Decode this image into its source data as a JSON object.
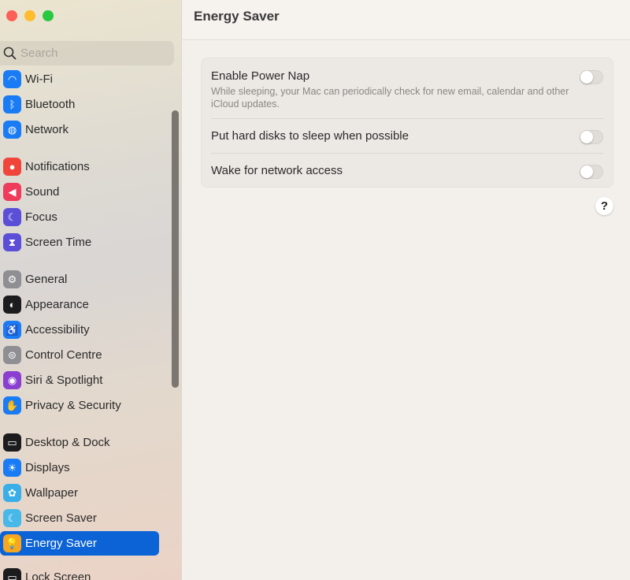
{
  "window": {
    "title": "Energy Saver"
  },
  "search": {
    "placeholder": "Search"
  },
  "sidebar": {
    "items": [
      {
        "label": "Wi-Fi",
        "icon": "wifi-icon",
        "color": "#1a7cf5",
        "glyph": "◠"
      },
      {
        "label": "Bluetooth",
        "icon": "bluetooth-icon",
        "color": "#1a7cf5",
        "glyph": "ᛒ"
      },
      {
        "label": "Network",
        "icon": "globe-icon",
        "color": "#1a7cf5",
        "glyph": "◍"
      },
      {
        "label": "Notifications",
        "icon": "bell-icon",
        "color": "#f0453a",
        "glyph": "●"
      },
      {
        "label": "Sound",
        "icon": "speaker-icon",
        "color": "#ee3b5b",
        "glyph": "◀"
      },
      {
        "label": "Focus",
        "icon": "moon-icon",
        "color": "#5a4fd6",
        "glyph": "☾"
      },
      {
        "label": "Screen Time",
        "icon": "hourglass-icon",
        "color": "#5a4fd6",
        "glyph": "⧗"
      },
      {
        "label": "General",
        "icon": "gear-icon",
        "color": "#8e8e93",
        "glyph": "⚙"
      },
      {
        "label": "Appearance",
        "icon": "appearance-icon",
        "color": "#1c1c1e",
        "glyph": "◐"
      },
      {
        "label": "Accessibility",
        "icon": "accessibility-icon",
        "color": "#1a7cf5",
        "glyph": "♿"
      },
      {
        "label": "Control Centre",
        "icon": "toggles-icon",
        "color": "#8e8e93",
        "glyph": "⊜"
      },
      {
        "label": "Siri & Spotlight",
        "icon": "siri-icon",
        "color": "#8a3fd0",
        "glyph": "◉"
      },
      {
        "label": "Privacy & Security",
        "icon": "hand-icon",
        "color": "#1a7cf5",
        "glyph": "✋"
      },
      {
        "label": "Desktop & Dock",
        "icon": "dock-icon",
        "color": "#1c1c1e",
        "glyph": "▭"
      },
      {
        "label": "Displays",
        "icon": "sun-icon",
        "color": "#1a7cf5",
        "glyph": "☀"
      },
      {
        "label": "Wallpaper",
        "icon": "flower-icon",
        "color": "#3aaee8",
        "glyph": "✿"
      },
      {
        "label": "Screen Saver",
        "icon": "screensaver-icon",
        "color": "#48b8e8",
        "glyph": "☾"
      },
      {
        "label": "Energy Saver",
        "icon": "bulb-icon",
        "color": "#f5a623",
        "glyph": "💡",
        "selected": true
      },
      {
        "label": "Lock Screen",
        "icon": "lock-screen-icon",
        "color": "#1c1c1e",
        "glyph": "▭"
      }
    ]
  },
  "settings": [
    {
      "label": "Enable Power Nap",
      "description": "While sleeping, your Mac can periodically check for new email, calendar and other iCloud updates.",
      "enabled": false
    },
    {
      "label": "Put hard disks to sleep when possible",
      "enabled": false
    },
    {
      "label": "Wake for network access",
      "enabled": false
    }
  ],
  "help": {
    "label": "?"
  }
}
